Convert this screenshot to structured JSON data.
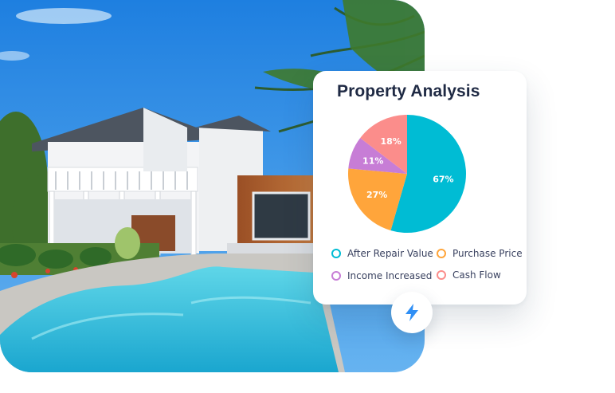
{
  "card": {
    "title": "Property Analysis"
  },
  "chart_data": {
    "type": "pie",
    "title": "Property Analysis",
    "slices": [
      {
        "name": "After Repair Value",
        "value": 67,
        "label": "67%",
        "color": "#00bcd4"
      },
      {
        "name": "Purchase Price",
        "value": 27,
        "label": "27%",
        "color": "#ffa53b"
      },
      {
        "name": "Income Increased",
        "value": 11,
        "label": "11%",
        "color": "#c77dd6"
      },
      {
        "name": "Cash Flow",
        "value": 18,
        "label": "18%",
        "color": "#fb8d8b"
      }
    ]
  },
  "legend": {
    "items": [
      {
        "label": "After Repair Value",
        "color": "#00bcd4"
      },
      {
        "label": "Purchase Price",
        "color": "#ffa53b"
      },
      {
        "label": "Income Increased",
        "color": "#c77dd6"
      },
      {
        "label": "Cash Flow",
        "color": "#fb8d8b"
      }
    ]
  },
  "badge": {
    "icon": "lightning-bolt-icon",
    "color": "#2f8ff5"
  }
}
